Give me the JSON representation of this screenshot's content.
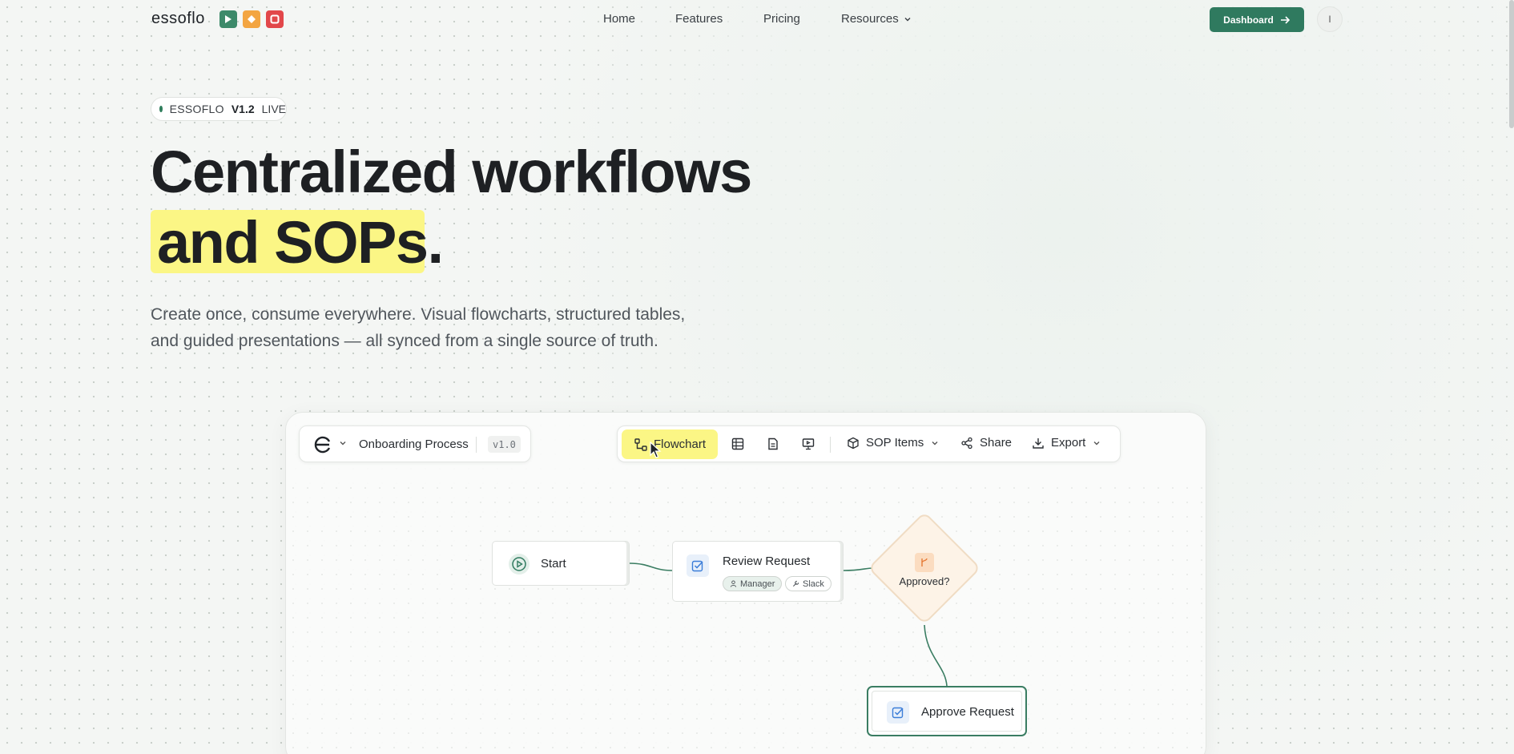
{
  "nav": {
    "logo": "essoflo",
    "links": {
      "home": "Home",
      "features": "Features",
      "pricing": "Pricing",
      "resources": "Resources"
    },
    "dashboard_label": "Dashboard",
    "avatar_initial": "I"
  },
  "hero": {
    "badge": {
      "name": "ESSOFLO",
      "version": "V1.2",
      "status": "LIVE"
    },
    "title_line1": "Centralized workflows",
    "title_line2": "and SOPs.",
    "subtitle_line1": "Create once, consume everywhere. Visual flowcharts, structured tables,",
    "subtitle_line2": "and guided presentations — all synced from a single source of truth."
  },
  "app": {
    "doc_title": "Onboarding Process",
    "doc_version": "v1.0",
    "toolbar": {
      "flowchart_label": "Flowchart",
      "views": [
        "table-icon",
        "document-icon",
        "presentation-icon"
      ],
      "sop_items_label": "SOP Items",
      "share_label": "Share",
      "export_label": "Export"
    },
    "flow": {
      "start_label": "Start",
      "review_label": "Review Request",
      "review_tags": [
        "Manager",
        "Slack"
      ],
      "decision_label": "Approved?",
      "approve_label": "Approve Request"
    }
  },
  "colors": {
    "accent_green": "#2f7a5f",
    "highlight_yellow": "#fbf685",
    "logo_green": "#3d8a6a",
    "logo_orange": "#f3a541",
    "logo_red": "#e2474a"
  }
}
